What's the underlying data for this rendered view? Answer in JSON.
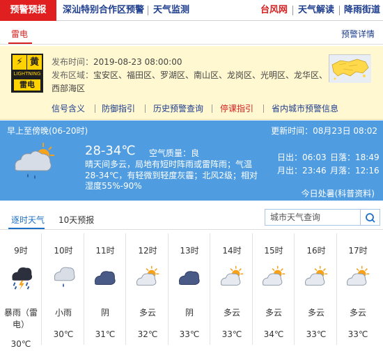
{
  "topnav": {
    "primary": "预警预报",
    "tabs": [
      "深汕特别合作区预警",
      "天气监测"
    ],
    "right": [
      "台风网",
      "天气解读",
      "降雨街道"
    ]
  },
  "subheader": {
    "active_tab": "雷电",
    "details": "预警详情"
  },
  "warning": {
    "badge_level": "黄",
    "badge_en": "LIGHTNING",
    "badge_cn": "雷电",
    "time_label": "发布时间：",
    "time_value": "2019-08-23 08:00:00",
    "area_label": "发布区域：",
    "areas": "宝安区、福田区、罗湖区、南山区、龙岗区、光明区、龙华区、",
    "areas_cont": "西部海区",
    "links": [
      "信号含义",
      "防御指引",
      "历史预警查询",
      "停课指引",
      "省内城市预警信息"
    ]
  },
  "now": {
    "period": "早上至傍晚(06-20时)",
    "update": "更新时间：08月23日 08:02",
    "temp": "28-34℃",
    "aqi": "空气质量：良",
    "desc": "晴天间多云，局地有短时阵雨或雷阵雨；气温28-34℃，有轻微到轻度灰霾；北风2级；相对湿度55%-90%",
    "sunrise": "日出：06:03",
    "sunset": "日落：18:49",
    "moonrise": "月出：23:46",
    "moonset": "月落：12:16",
    "source": "今日处暑(科普资料)"
  },
  "tabs": {
    "hourly": "逐时天气",
    "tenday": "10天预报"
  },
  "search": {
    "placeholder": "城市天气查询"
  },
  "hourly": [
    {
      "time": "9时",
      "icon": "thunderstorm-icon",
      "cond": "暴雨（雷电）",
      "temp": "30℃"
    },
    {
      "time": "10时",
      "icon": "light-rain-icon",
      "cond": "小雨",
      "temp": "30℃"
    },
    {
      "time": "11时",
      "icon": "overcast-icon",
      "cond": "阴",
      "temp": "31℃"
    },
    {
      "time": "12时",
      "icon": "partly-cloudy-icon",
      "cond": "多云",
      "temp": "32℃"
    },
    {
      "time": "13时",
      "icon": "overcast-icon",
      "cond": "阴",
      "temp": "33℃"
    },
    {
      "time": "14时",
      "icon": "partly-cloudy-icon",
      "cond": "多云",
      "temp": "33℃"
    },
    {
      "time": "15时",
      "icon": "partly-cloudy-icon",
      "cond": "多云",
      "temp": "34℃"
    },
    {
      "time": "16时",
      "icon": "partly-cloudy-icon",
      "cond": "多云",
      "temp": "33℃"
    },
    {
      "time": "17时",
      "icon": "partly-cloudy-icon",
      "cond": "多云",
      "temp": "33℃"
    }
  ],
  "colors": {
    "alert_red": "#e02020",
    "panel_blue": "#4f9ce0",
    "warn_yellow": "#fff8d0",
    "link_blue": "#1d3d8e"
  }
}
